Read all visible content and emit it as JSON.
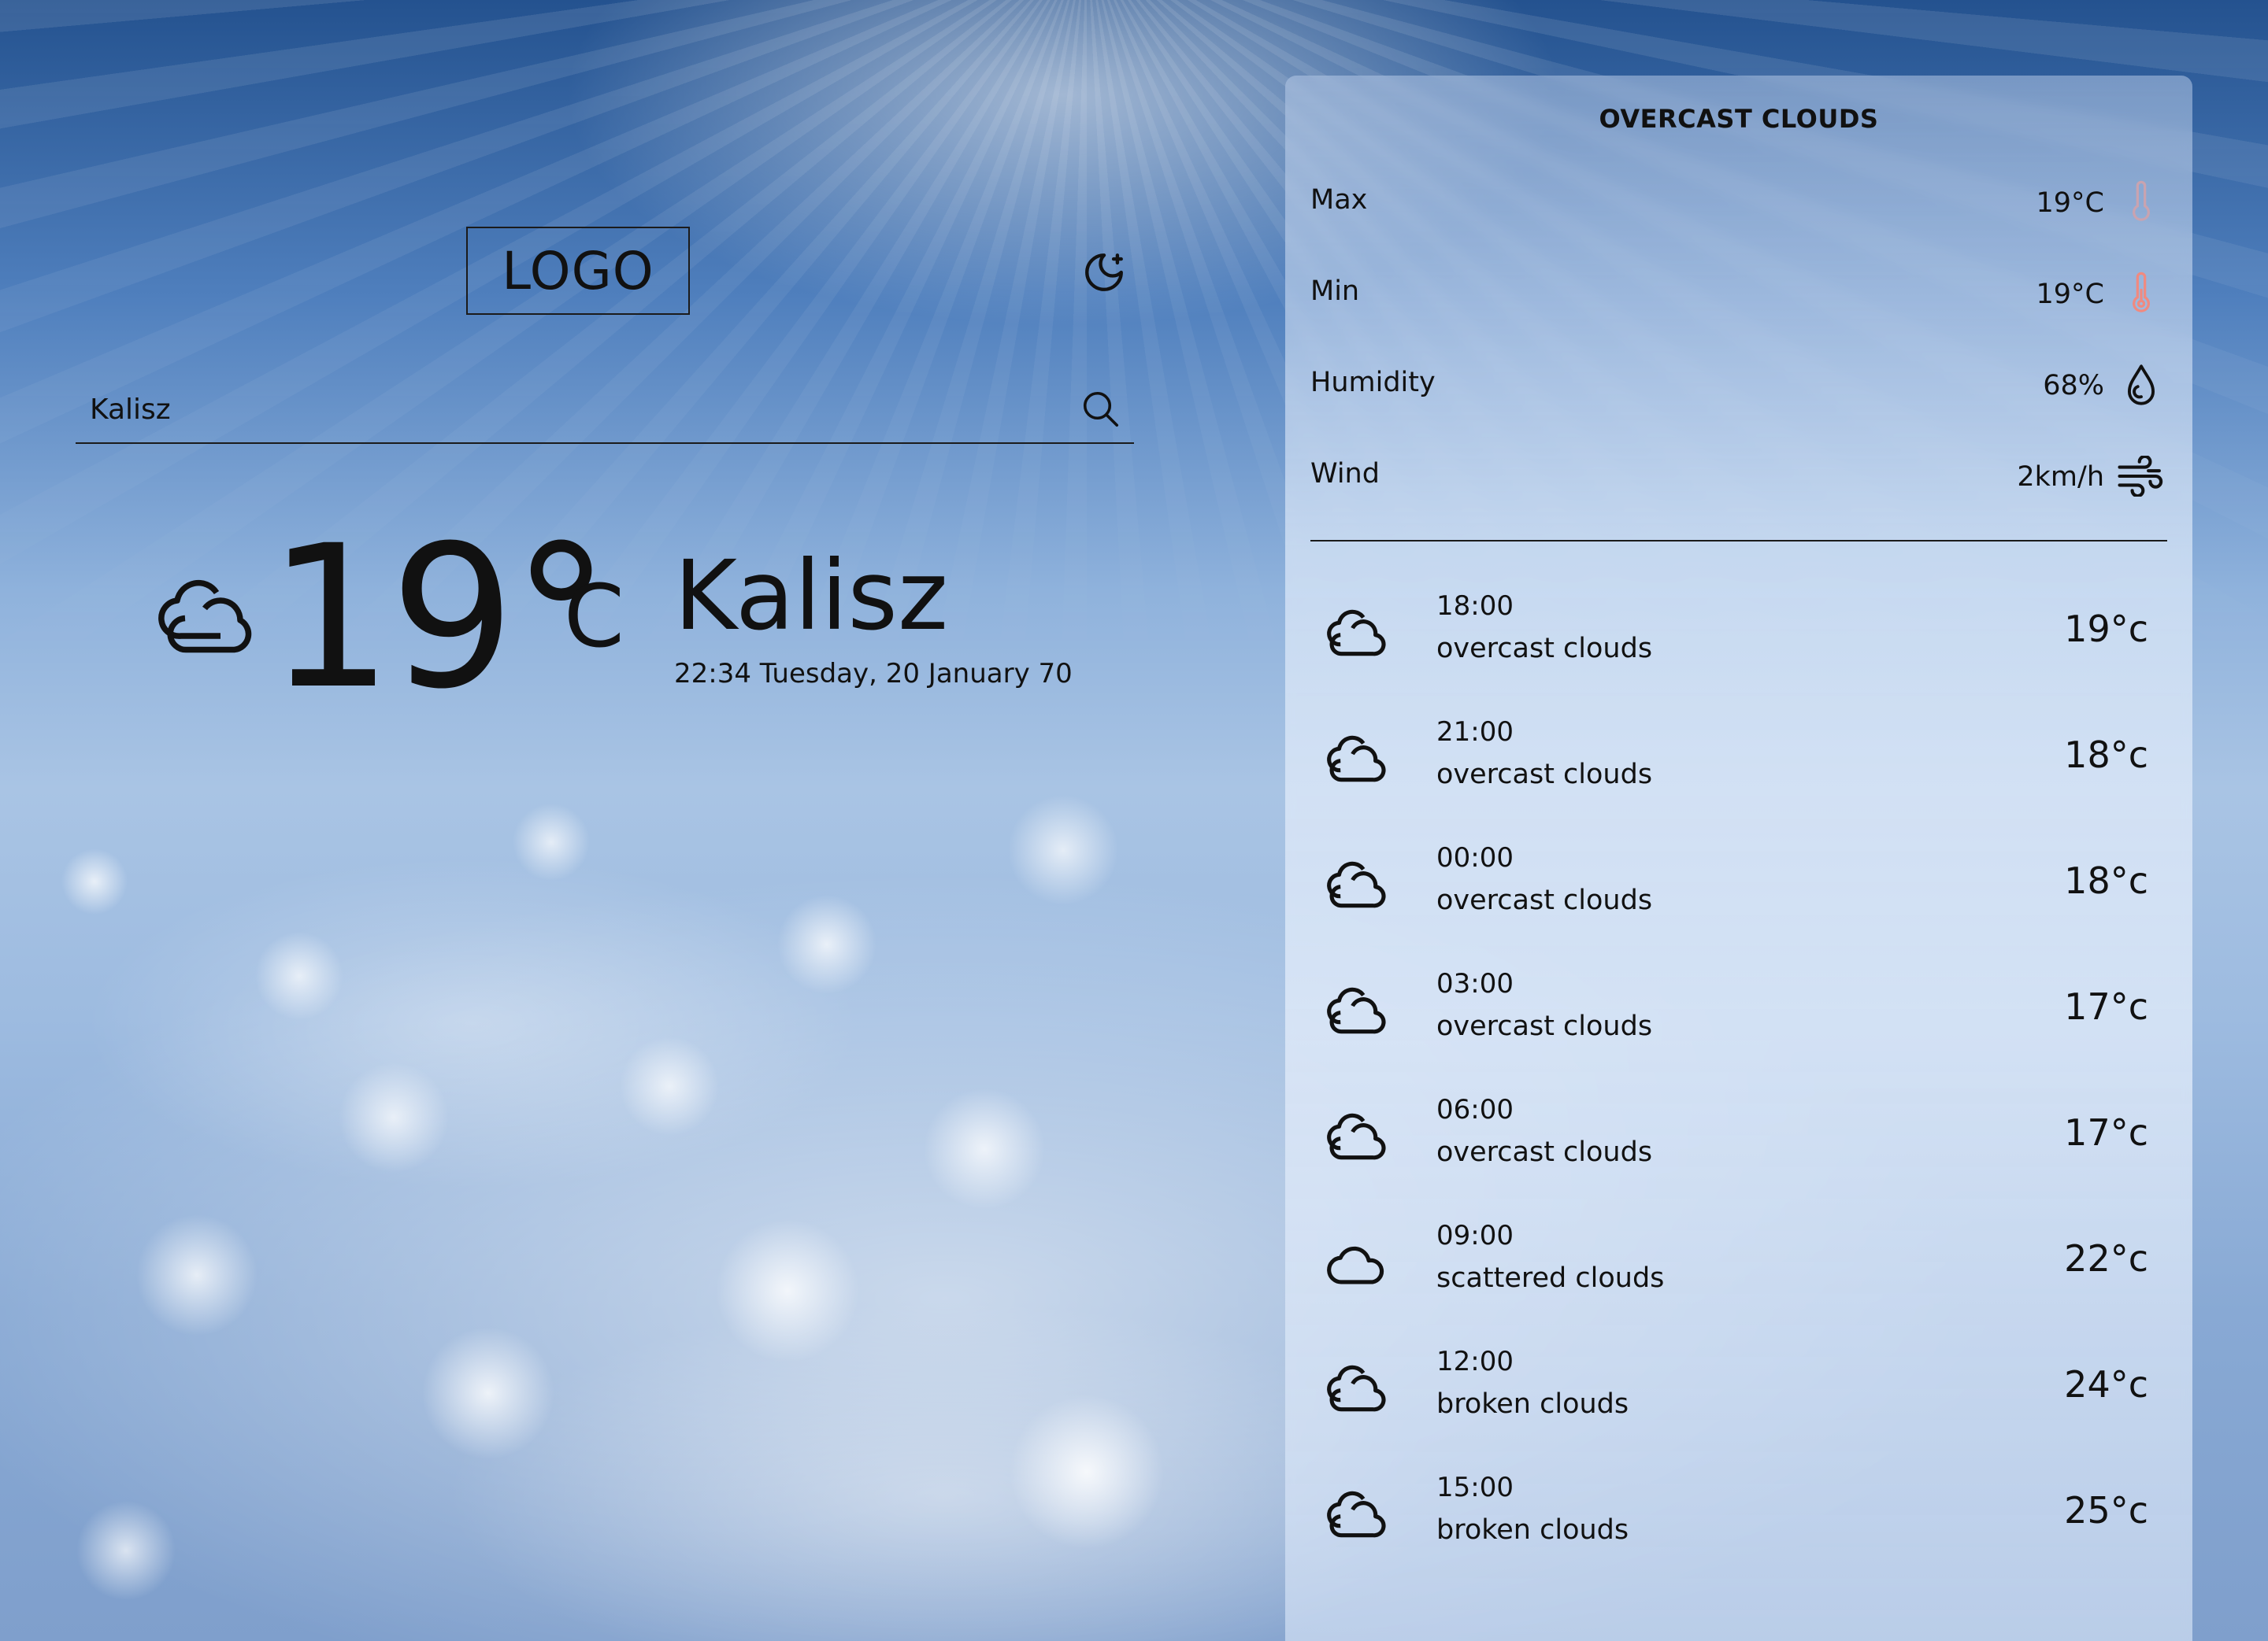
{
  "header": {
    "logo_text": "LOGO",
    "theme_toggle_icon": "moon-stars-icon"
  },
  "search": {
    "value": "Kalisz",
    "placeholder": "",
    "icon": "search-icon"
  },
  "current": {
    "icon": "cloud-icon",
    "temperature": "19°",
    "unit": "C",
    "city": "Kalisz",
    "datetime": "22:34 Tuesday, 20 January 70"
  },
  "details": {
    "title": "OVERCAST CLOUDS",
    "stats": [
      {
        "label": "Max",
        "value": "19°C",
        "icon": "thermometer-icon",
        "icon_color": "#c9a3b0"
      },
      {
        "label": "Min",
        "value": "19°C",
        "icon": "thermometer-icon",
        "icon_color": "#f08a80"
      },
      {
        "label": "Humidity",
        "value": "68%",
        "icon": "water-drop-icon",
        "icon_color": "#111111"
      },
      {
        "label": "Wind",
        "value": "2km/h",
        "icon": "wind-icon",
        "icon_color": "#111111"
      }
    ]
  },
  "forecast": [
    {
      "time": "18:00",
      "description": "overcast clouds",
      "temp": "19°c",
      "icon": "clouds-icon"
    },
    {
      "time": "21:00",
      "description": "overcast clouds",
      "temp": "18°c",
      "icon": "clouds-icon"
    },
    {
      "time": "00:00",
      "description": "overcast clouds",
      "temp": "18°c",
      "icon": "clouds-icon"
    },
    {
      "time": "03:00",
      "description": "overcast clouds",
      "temp": "17°c",
      "icon": "clouds-icon"
    },
    {
      "time": "06:00",
      "description": "overcast clouds",
      "temp": "17°c",
      "icon": "clouds-icon"
    },
    {
      "time": "09:00",
      "description": "scattered clouds",
      "temp": "22°c",
      "icon": "cloud-icon"
    },
    {
      "time": "12:00",
      "description": "broken clouds",
      "temp": "24°c",
      "icon": "clouds-icon"
    },
    {
      "time": "15:00",
      "description": "broken clouds",
      "temp": "25°c",
      "icon": "clouds-icon"
    }
  ]
}
